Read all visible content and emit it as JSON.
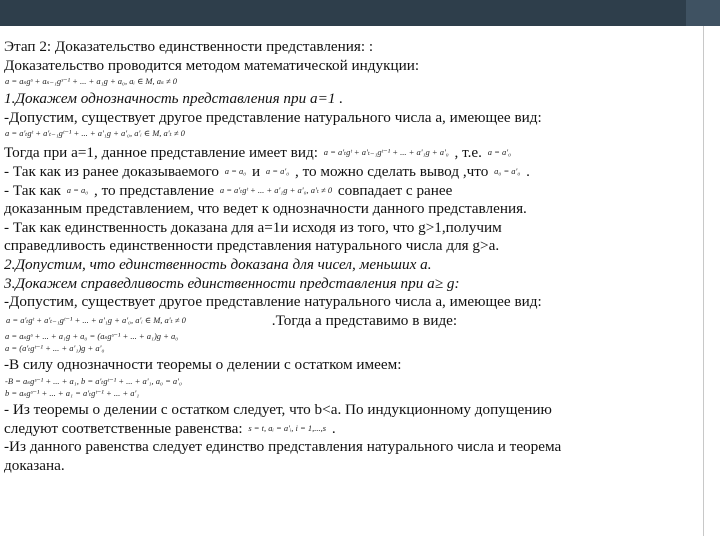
{
  "lines": {
    "l1": "Этап 2: Доказательство единственности представления: :",
    "l2": "Доказательство проводится методом математической индукции:",
    "f1": "a = aₛgˢ + aₛ₋₁gˢ⁻¹ + ... + a₁g + a₀, aᵢ ∈ M, aₛ ≠ 0",
    "l3": "1.Докажем однозначность представления при a=1 .",
    "l4": "-Допустим, существует другое представление натурального числа a, имеющее вид:",
    "f2": "a = a'ₜgᵗ + a'ₜ₋₁gᵗ⁻¹ + ... + a'₁g + a'₀, a'ᵢ ∈ M, a'ₜ ≠ 0",
    "l5a": "Тогда при a=1, данное представление имеет вид:",
    "f3": "a = a'ₜgᵗ + a'ₜ₋₁gᵗ⁻¹ + ... + a'₁g + a'₀",
    "l5b": ", т.е.",
    "f3b": "a = a'₀",
    "l6a": "- Так как из ранее доказываемого",
    "f4a": "a = a₀",
    "l6b": "и",
    "f4b": "a = a'₀",
    "l6c": ", то можно сделать вывод ,что",
    "f4c": "a₀ = a'₀",
    "l6d": ".",
    "l7a": "- Так как",
    "f5a": "a = a₀",
    "l7b": ", то представление",
    "f5b": "a = a'ₜgᵗ + ... + a'₁g + a'₀, a'ₜ ≠ 0",
    "l7c": "совпадает с ранее",
    "l8": "доказанным представлением, что ведет к однозначности данного представления.",
    "l9": "- Так как единственность доказана для a=1и исходя из того, что g>1,получим",
    "l10": "справедливость единственности представления натурального числа для g>a.",
    "l11": "2.Допустим, что единственность доказана для чисел, меньших а.",
    "l12": "3.Докажем справедливость единственности представления при a≥ g:",
    "l13": "-Допустим, существует другое представление натурального числа a, имеющее вид:",
    "f6": "a = a'ₜgᵗ + a'ₜ₋₁gᵗ⁻¹ + ... + a'₁g + a'₀, a'ᵢ ∈ M, a'ₜ ≠ 0",
    "l14": ".Тогда a представимо в виде:",
    "f7": "a = aₛgˢ + ... + a₁g + a₀ = (aₛgˢ⁻¹ + ... + a₁)g + a₀",
    "f8": "a = (a'ₜgᵗ⁻¹ + ... + a'₁)g + a'₀",
    "l15": "-В силу однозначности теоремы о делении с остатком имеем:",
    "f9": "-B = aₛgˢ⁻¹ + ... + a₁, b = a'ₜgᵗ⁻¹ + ... + a'₁, a₀ = a'₀",
    "f10": "b = aₛgˢ⁻¹ + ... + a₁ = a'ₜgᵗ⁻¹ + ... + a'₁",
    "l16": "- Из теоремы о делении с остатком следует, что b<a. По индукционному допущению",
    "l17a": "следуют соответственные равенства:",
    "f11": "s = t, aᵢ = a'ᵢ, i = 1,...,s",
    "l17b": ".",
    "l18": "-Из данного равенства следует единство представления натурального числа и теорема",
    "l19": "доказана."
  }
}
